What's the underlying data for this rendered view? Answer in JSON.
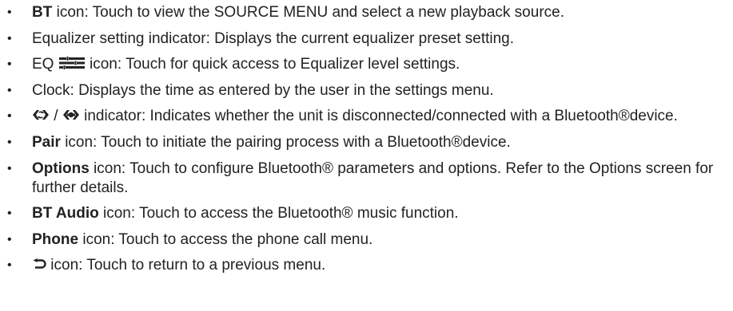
{
  "items": [
    {
      "term": "BT",
      "text": " icon: Touch to view the SOURCE MENU and select a new playback source."
    },
    {
      "text": "Equalizer setting indicator: Displays the current equalizer preset setting."
    },
    {
      "prefix": "EQ ",
      "icon": "equalizer-bars-icon",
      "text": " icon: Touch for quick access to Equalizer level settings."
    },
    {
      "text": "Clock: Displays the time as entered by the user in the settings menu."
    },
    {
      "icon_disconnected": "bluetooth-disconnected-icon",
      "separator": " / ",
      "icon_connected": "bluetooth-connected-icon",
      "text": " indicator: Indicates whether the unit is disconnected/connected with a Bluetooth®device."
    },
    {
      "term": "Pair",
      "text": " icon: Touch to initiate the pairing process with a Bluetooth®device."
    },
    {
      "term": "Options",
      "text": " icon: Touch to configure Bluetooth® parameters and options. Refer to the Options screen for further details."
    },
    {
      "term": "BT Audio",
      "text": " icon: Touch to access the Bluetooth® music function."
    },
    {
      "term": "Phone",
      "text": " icon: Touch to access the phone call menu."
    },
    {
      "icon": "return-arrow-icon",
      "text": " icon: Touch to return to a previous menu."
    }
  ],
  "bullet_glyph": "•"
}
